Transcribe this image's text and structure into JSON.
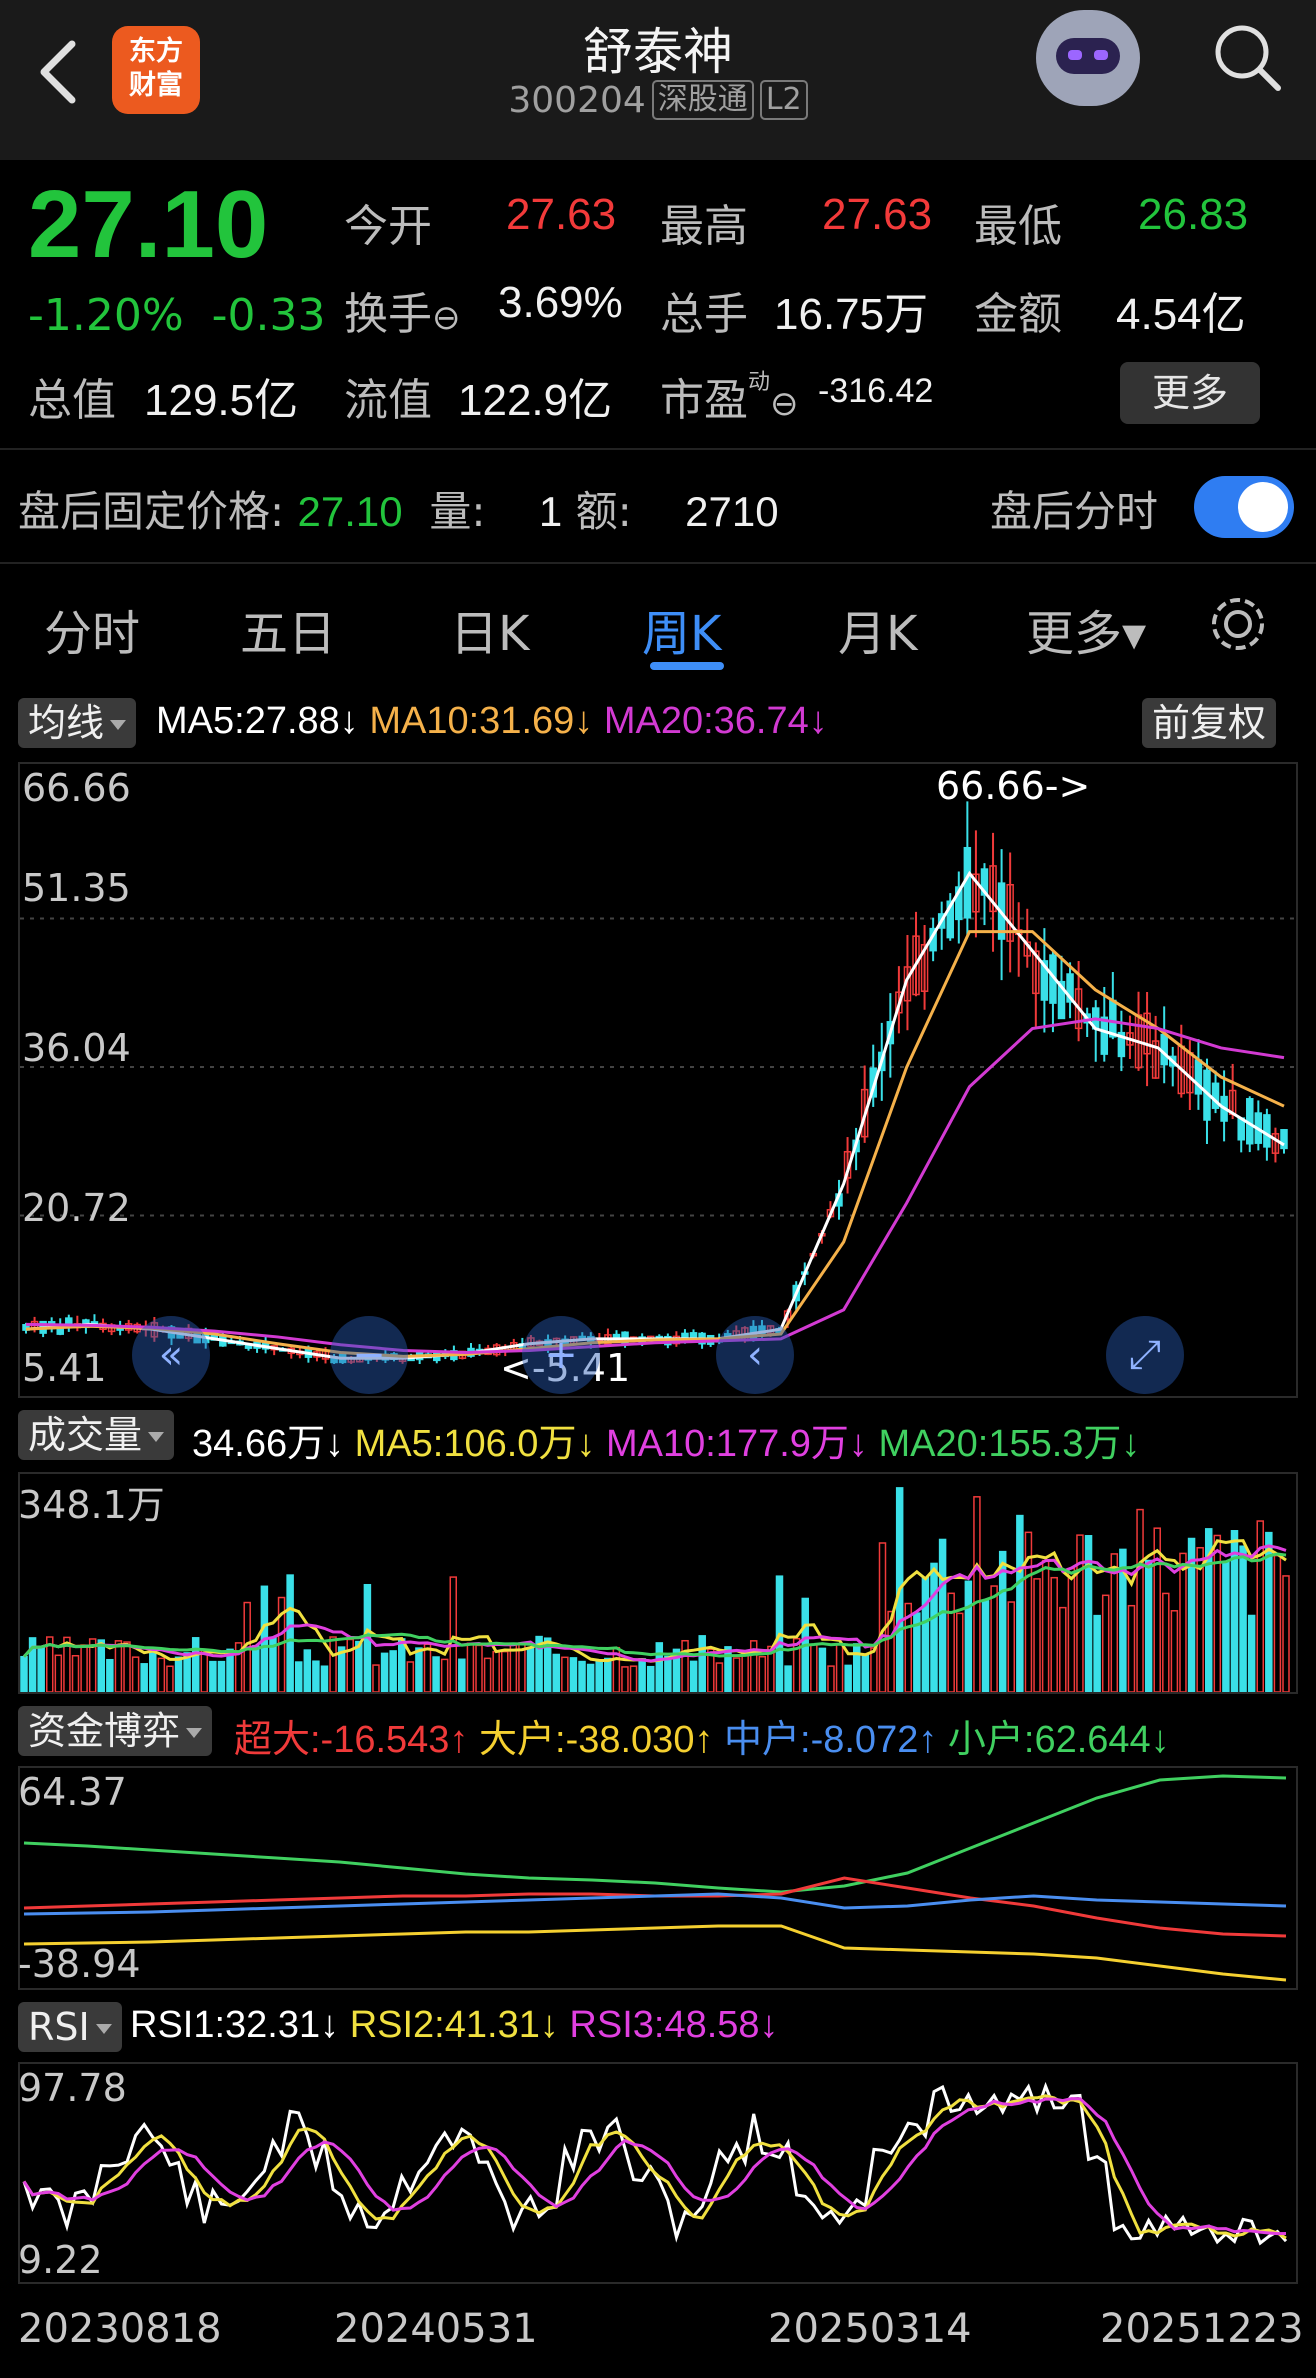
{
  "header": {
    "back_icon": "chevron-left-icon",
    "logo_text_1": "东方",
    "logo_text_2": "财富",
    "title": "舒泰神",
    "code": "300204",
    "tag_1": "深股通",
    "tag_2": "L2",
    "avatar_icon": "robot-avatar-icon",
    "search_icon": "search-icon"
  },
  "quote": {
    "price": "27.10",
    "change_pct": "-1.20%",
    "change_amt": "-0.33",
    "open_label": "今开",
    "open_value": "27.63",
    "high_label": "最高",
    "high_value": "27.63",
    "low_label": "最低",
    "low_value": "26.83",
    "turnover_label": "换手",
    "turnover_value": "3.69%",
    "volume_label": "总手",
    "volume_value": "16.75万",
    "amount_label": "金额",
    "amount_value": "4.54亿",
    "mcap_label": "总值",
    "mcap_value": "129.5亿",
    "float_label": "流值",
    "float_value": "122.9亿",
    "pe_label": "市盈",
    "pe_sup": "动",
    "pe_value": "-316.42",
    "more_label": "更多"
  },
  "after_hours": {
    "price_label": "盘后固定价格:",
    "price_value": "27.10",
    "qty_label": "量:",
    "qty_value": "1",
    "amt_label": "额:",
    "amt_value": "2710",
    "timeshare_label": "盘后分时",
    "toggle_on": true
  },
  "tabs": [
    {
      "label": "分时"
    },
    {
      "label": "五日"
    },
    {
      "label": "日K"
    },
    {
      "label": "周K"
    },
    {
      "label": "月K"
    },
    {
      "label": "更多▾"
    }
  ],
  "active_tab": "周K",
  "ma_bar": {
    "selector": "均线",
    "ma5": "MA5:27.88↓",
    "ma10": "MA10:31.69↓",
    "ma20": "MA20:36.74↓",
    "adjust": "前复权",
    "colors": {
      "ma5": "#ffffff",
      "ma10": "#f5b14a",
      "ma20": "#d23ad2"
    }
  },
  "vol_bar": {
    "selector": "成交量",
    "vol": "34.66万↓",
    "ma5": "MA5:106.0万↓",
    "ma10": "MA10:177.9万↓",
    "ma20": "MA20:155.3万↓"
  },
  "fund_bar": {
    "selector": "资金博弈",
    "super": "超大:-16.543↑",
    "large": "大户:-38.030↑",
    "medium": "中户:-8.072↑",
    "small": "小户:62.644↓"
  },
  "rsi_bar": {
    "selector": "RSI",
    "rsi1": "RSI1:32.31↓",
    "rsi2": "RSI2:41.31↓",
    "rsi3": "RSI3:48.58↓"
  },
  "price_axis": [
    "66.66",
    "51.35",
    "36.04",
    "20.72",
    "5.41"
  ],
  "max_marker": "66.66->",
  "min_marker": "<-5.41",
  "vol_axis_top": "348.1万",
  "fund_axis": [
    "64.37",
    "-38.94"
  ],
  "rsi_axis": [
    "97.78",
    "9.22"
  ],
  "dates": [
    "20230818",
    "20240531",
    "20250314",
    "20251223"
  ],
  "chart_data": [
    {
      "type": "line",
      "title": "",
      "series": [
        {
          "name": "MA5",
          "values": [
            9,
            9.5,
            9,
            8,
            7,
            6,
            6,
            6.5,
            7.5,
            8,
            8,
            8,
            9,
            24,
            45,
            56,
            48,
            40,
            38,
            32,
            28
          ]
        },
        {
          "name": "MA10",
          "values": [
            9,
            9.3,
            9.1,
            8.5,
            7.5,
            6.6,
            6.2,
            6.4,
            7,
            7.6,
            7.9,
            8,
            8.5,
            18,
            36,
            50,
            50,
            44,
            40,
            35,
            32
          ]
        },
        {
          "name": "MA20",
          "values": [
            9.5,
            9.4,
            9.2,
            8.8,
            8.2,
            7.4,
            6.8,
            6.6,
            6.8,
            7.2,
            7.6,
            7.8,
            8,
            11,
            22,
            34,
            40,
            41,
            40,
            38,
            37
          ]
        }
      ],
      "ylim": [
        5.41,
        66.66
      ]
    }
  ]
}
